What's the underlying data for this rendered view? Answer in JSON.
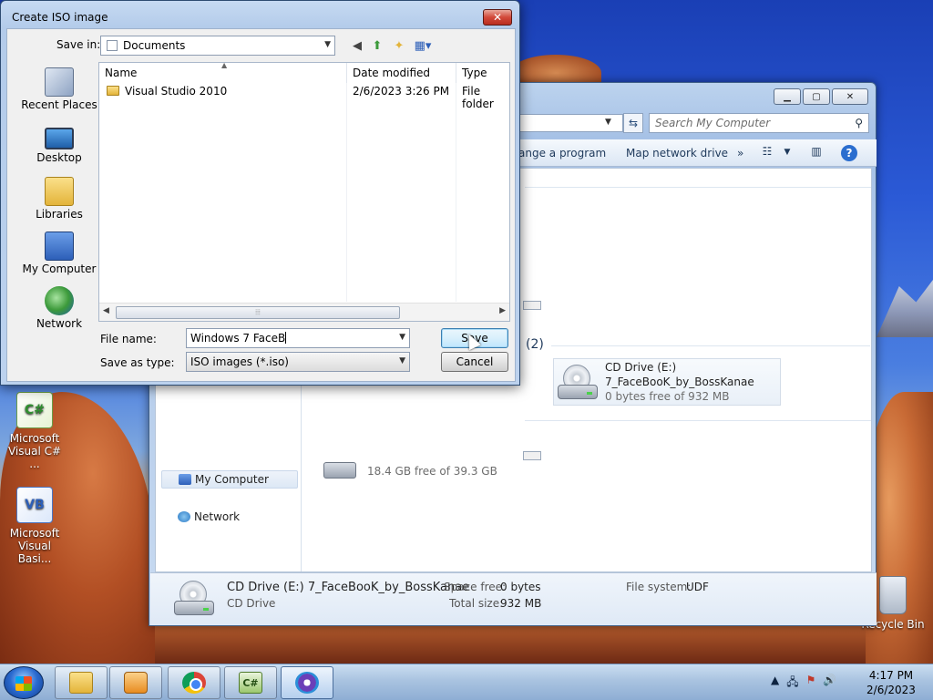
{
  "dialog": {
    "title": "Create ISO image",
    "close_glyph": "✕",
    "save_in_label": "Save in:",
    "save_in_value": "Documents",
    "places": [
      {
        "label": "Recent Places",
        "icon": "recent-places-icon"
      },
      {
        "label": "Desktop",
        "icon": "desktop-icon"
      },
      {
        "label": "Libraries",
        "icon": "libraries-icon"
      },
      {
        "label": "My Computer",
        "icon": "my-computer-icon"
      },
      {
        "label": "Network",
        "icon": "network-icon"
      }
    ],
    "columns": {
      "name": "Name",
      "date": "Date modified",
      "type": "Type"
    },
    "files": [
      {
        "name": "Visual Studio 2010",
        "date": "2/6/2023 3:26 PM",
        "type": "File folder"
      }
    ],
    "file_name_label": "File name:",
    "file_name_value": "Windows 7 FaceB",
    "save_as_type_label": "Save as type:",
    "save_as_type_value": "ISO images (*.iso)",
    "save_button": "Save",
    "cancel_button": "Cancel"
  },
  "explorer": {
    "search_placeholder": "Search My Computer",
    "toolbar": {
      "change_program": "ange a program",
      "map_network_drive": "Map network drive",
      "more": "»"
    },
    "group_count": "(2)",
    "cd_tile": {
      "title": "CD Drive (E:)",
      "label": "7_FaceBooK_by_BossKanae",
      "free": "0 bytes free of 932 MB"
    },
    "partial_drive_text": "18.4 GB free of 39.3 GB",
    "nav": [
      {
        "label": "My Computer"
      },
      {
        "label": "Network"
      }
    ],
    "details": {
      "title": "CD Drive (E:) 7_FaceBooK_by_BossKanae",
      "subtitle": "CD Drive",
      "space_free_label": "Space free:",
      "space_free_value": "0 bytes",
      "total_size_label": "Total size:",
      "total_size_value": "932 MB",
      "file_system_label": "File system:",
      "file_system_value": "UDF"
    }
  },
  "desktop": {
    "icons": [
      {
        "label": "Microsoft Visual C# ...",
        "glyph": "C#"
      },
      {
        "label": "Microsoft Visual Basi...",
        "glyph": "VB"
      }
    ],
    "recycle_bin": "Recycle Bin"
  },
  "taskbar": {
    "clock_time": "4:17 PM",
    "clock_date": "2/6/2023",
    "cs_glyph": "C#"
  }
}
